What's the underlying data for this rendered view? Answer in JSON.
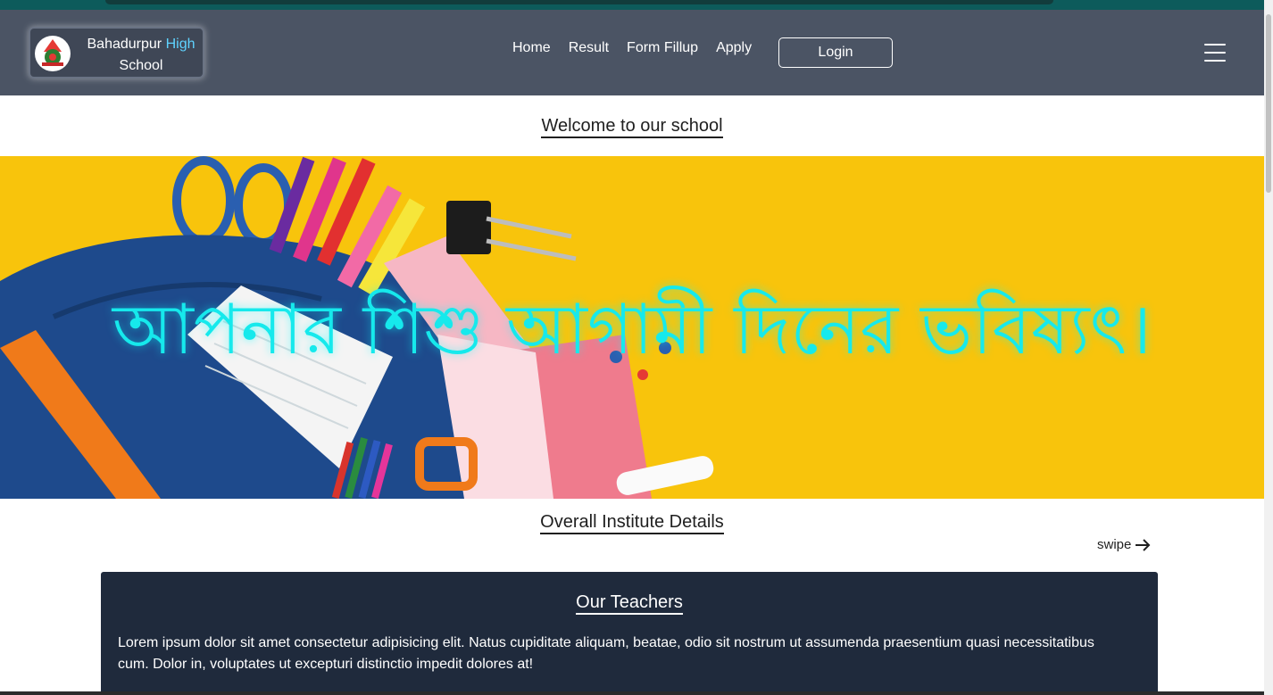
{
  "brand": {
    "name_part1": "Bahadurpur",
    "name_highlight": "High",
    "name_part2": "School",
    "highlight_color": "#5fd3ff"
  },
  "nav": {
    "links": [
      "Home",
      "Result",
      "Form Fillup",
      "Apply"
    ],
    "login_label": "Login",
    "menu_icon": "hamburger-menu-icon"
  },
  "welcome": "Welcome to our school",
  "banner": {
    "text": "আপনার শিশু আগামী দিনের ভবিষ্যৎ।",
    "text_color": "#16e9ec",
    "background_color": "#f8c40c"
  },
  "details": {
    "title": "Overall Institute Details",
    "swipe_label": "swipe",
    "swipe_icon": "arrow-right-icon"
  },
  "teachers": {
    "title": "Our Teachers",
    "body": "Lorem ipsum dolor sit amet consectetur adipisicing elit. Natus cupiditate aliquam, beatae, odio sit nostrum ut assumenda praesentium quasi necessitatibus cum. Dolor in, voluptates ut excepturi distinctio impedit dolores at!"
  },
  "colors": {
    "navbar": "#4b5464",
    "card": "#1f2a3c",
    "accent_top": "#0d5b5b"
  }
}
